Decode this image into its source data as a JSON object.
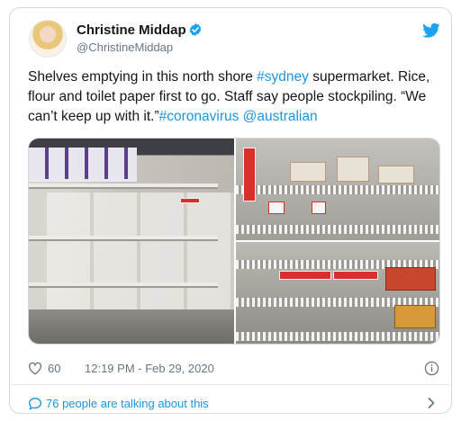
{
  "tweet": {
    "author_name": "Christine Middap",
    "handle": "@ChristineMiddap",
    "text_segments": [
      {
        "text": "Shelves emptying in this north shore ",
        "type": "plain"
      },
      {
        "text": "#sydney",
        "type": "link"
      },
      {
        "text": " supermarket. Rice, flour and toilet paper first to go. Staff say people stockpiling. “We can’t keep up with it.”",
        "type": "plain"
      },
      {
        "text": "#coronavirus",
        "type": "link"
      },
      {
        "text": " ",
        "type": "plain"
      },
      {
        "text": "@australian",
        "type": "link"
      }
    ],
    "likes": "60",
    "timestamp": "12:19 PM - Feb 29, 2020",
    "conversation_link": "76 people are talking about this"
  },
  "media": {
    "photos": [
      {
        "name": "photo-empty-aisle"
      },
      {
        "name": "photo-rice-shelves"
      },
      {
        "name": "photo-empty-lower-shelves"
      }
    ]
  },
  "colors": {
    "link": "#1b95e0",
    "secondary_text": "#657786",
    "border": "#cfd9de",
    "verified": "#1da1f2"
  },
  "icons": [
    "verified-badge-icon",
    "twitter-bird-icon",
    "heart-icon",
    "info-icon",
    "speech-bubble-icon",
    "chevron-right-icon"
  ]
}
